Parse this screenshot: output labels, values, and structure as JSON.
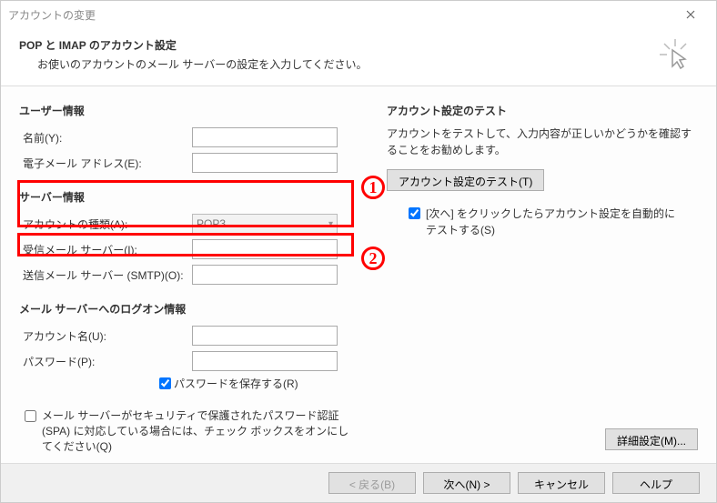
{
  "window": {
    "title": "アカウントの変更"
  },
  "header": {
    "title": "POP と IMAP のアカウント設定",
    "subtitle": "お使いのアカウントのメール サーバーの設定を入力してください。"
  },
  "left": {
    "user_section": "ユーザー情報",
    "name_label": "名前(Y):",
    "name_value": "",
    "email_label": "電子メール アドレス(E):",
    "email_value": "",
    "server_section": "サーバー情報",
    "acct_type_label": "アカウントの種類(A):",
    "acct_type_value": "POP3",
    "incoming_label": "受信メール サーバー(I):",
    "incoming_value": "",
    "outgoing_label": "送信メール サーバー (SMTP)(O):",
    "outgoing_value": "",
    "logon_section": "メール サーバーへのログオン情報",
    "account_label": "アカウント名(U):",
    "account_value": "",
    "password_label": "パスワード(P):",
    "password_value": "",
    "save_pw_label": "パスワードを保存する(R)",
    "spa_label": "メール サーバーがセキュリティで保護されたパスワード認証 (SPA) に対応している場合には、チェック ボックスをオンにしてください(Q)"
  },
  "right": {
    "test_section": "アカウント設定のテスト",
    "test_desc": "アカウントをテストして、入力内容が正しいかどうかを確認することをお勧めします。",
    "test_button": "アカウント設定のテスト(T)",
    "auto_test_label": "[次へ] をクリックしたらアカウント設定を自動的にテストする(S)",
    "detail_button": "詳細設定(M)..."
  },
  "footer": {
    "back": "< 戻る(B)",
    "next": "次へ(N) >",
    "cancel": "キャンセル",
    "help": "ヘルプ"
  },
  "annotations": {
    "n1": "1",
    "n2": "2"
  }
}
